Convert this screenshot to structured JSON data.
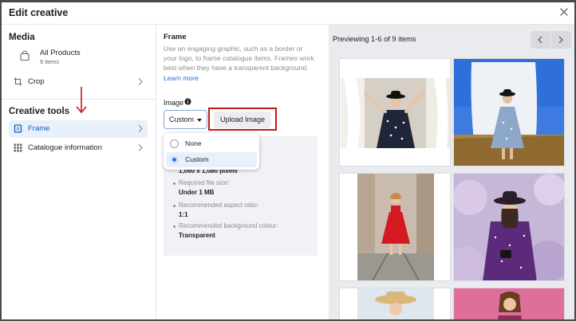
{
  "dialog": {
    "title": "Edit creative"
  },
  "sidebar": {
    "media_heading": "Media",
    "product": {
      "name": "All Products",
      "count": "9 items"
    },
    "crop_label": "Crop",
    "creative_heading": "Creative tools",
    "items": [
      {
        "label": "Frame",
        "active": true
      },
      {
        "label": "Catalogue information",
        "active": false
      }
    ]
  },
  "frame_panel": {
    "title": "Frame",
    "description": "Use an engaging graphic, such as a border or your logo, to frame catalogue items. Frames work best when they have a transparent background.",
    "learn_more": "Learn more",
    "image_label": "Image",
    "select_value": "Custom",
    "upload_label": "Upload Image",
    "options": [
      {
        "label": "None",
        "selected": false
      },
      {
        "label": "Custom",
        "selected": true
      }
    ],
    "requirements": [
      {
        "label": "",
        "value": "1,080 x 1,080 pixels"
      },
      {
        "label": "Required file size:",
        "value": "Under 1 MB"
      },
      {
        "label": "Recommended aspect ratio:",
        "value": "1:1"
      },
      {
        "label": "Recommended background colour:",
        "value": "Transparent"
      }
    ]
  },
  "preview": {
    "text": "Previewing 1-6 of 9 items",
    "items": [
      "white-dress-polka",
      "blue-dress-field",
      "red-dress-street",
      "purple-dress-hat",
      "straw-hat-woman",
      "pink-background-woman"
    ]
  },
  "colors": {
    "accent": "#1877f2",
    "annotation_red": "#c01b1b",
    "selected_bg": "#e7f0fb"
  }
}
